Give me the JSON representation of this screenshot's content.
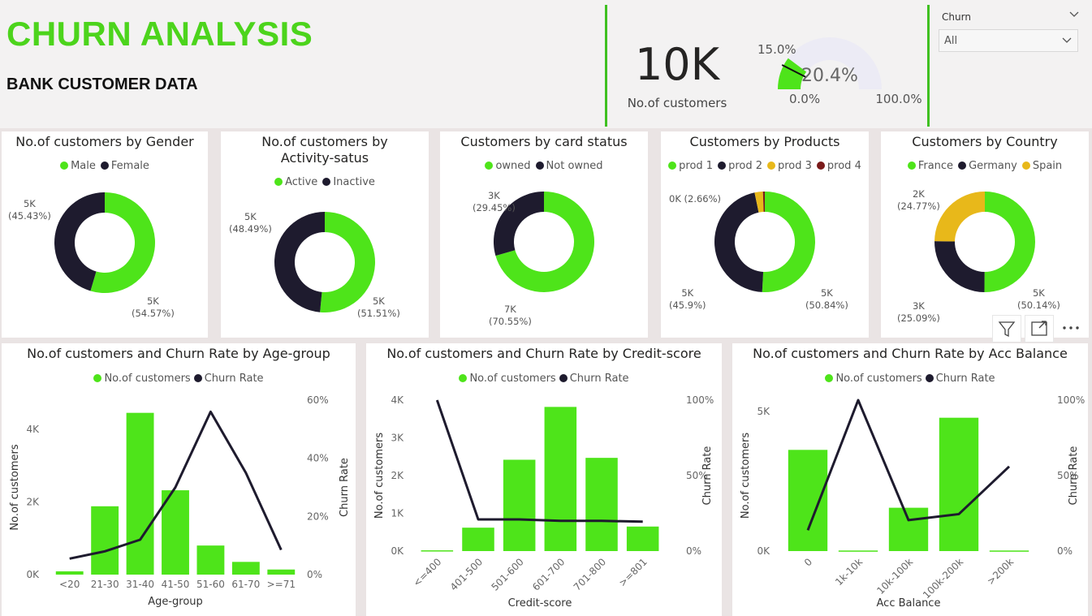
{
  "header": {
    "title": "CHURN ANALYSIS",
    "subtitle": "BANK CUSTOMER DATA"
  },
  "kpi": {
    "value": "10K",
    "label": "No.of customers"
  },
  "gauge": {
    "value": "20.4%",
    "target": "15.0%",
    "min": "0.0%",
    "max": "100.0%",
    "fill_fraction": 0.204,
    "target_fraction": 0.15
  },
  "slicer": {
    "title": "Churn",
    "selected": "All"
  },
  "colors": {
    "green": "#4ee41a",
    "dark": "#1e1b2e",
    "yellow": "#e8b81a",
    "maroon": "#7a1a1a",
    "gauge_bg": "#ecebf5"
  },
  "donuts": [
    {
      "title": "No.of customers by Gender",
      "legend": [
        {
          "label": "Male",
          "color": "#4ee41a"
        },
        {
          "label": "Female",
          "color": "#1e1b2e"
        }
      ],
      "slices": [
        {
          "value": 54.57,
          "color": "#4ee41a"
        },
        {
          "value": 45.43,
          "color": "#1e1b2e"
        }
      ],
      "labels": [
        {
          "line1": "5K",
          "line2": "(45.43%)"
        },
        {
          "line1": "5K",
          "line2": "(54.57%)"
        }
      ]
    },
    {
      "title": "No.of customers by Activity-satus",
      "legend": [
        {
          "label": "Active",
          "color": "#4ee41a"
        },
        {
          "label": "Inactive",
          "color": "#1e1b2e"
        }
      ],
      "slices": [
        {
          "value": 51.51,
          "color": "#4ee41a"
        },
        {
          "value": 48.49,
          "color": "#1e1b2e"
        }
      ],
      "labels": [
        {
          "line1": "5K",
          "line2": "(48.49%)"
        },
        {
          "line1": "5K",
          "line2": "(51.51%)"
        }
      ]
    },
    {
      "title": "Customers by card status",
      "legend": [
        {
          "label": "owned",
          "color": "#4ee41a"
        },
        {
          "label": "Not owned",
          "color": "#1e1b2e"
        }
      ],
      "slices": [
        {
          "value": 70.55,
          "color": "#4ee41a"
        },
        {
          "value": 29.45,
          "color": "#1e1b2e"
        }
      ],
      "labels": [
        {
          "line1": "3K",
          "line2": "(29.45%)"
        },
        {
          "line1": "7K",
          "line2": "(70.55%)"
        }
      ]
    },
    {
      "title": "Customers by Products",
      "legend": [
        {
          "label": "prod 1",
          "color": "#4ee41a"
        },
        {
          "label": "prod 2",
          "color": "#1e1b2e"
        },
        {
          "label": "prod 3",
          "color": "#e8b81a"
        },
        {
          "label": "prod 4",
          "color": "#7a1a1a"
        }
      ],
      "slices": [
        {
          "value": 50.84,
          "color": "#4ee41a"
        },
        {
          "value": 45.9,
          "color": "#1e1b2e"
        },
        {
          "value": 2.66,
          "color": "#e8b81a"
        },
        {
          "value": 0.6,
          "color": "#7a1a1a"
        }
      ],
      "labels": [
        {
          "line1": "0K (2.66%)",
          "line2": ""
        },
        {
          "line1": "5K",
          "line2": "(45.9%)"
        },
        {
          "line1": "5K",
          "line2": "(50.84%)"
        }
      ]
    },
    {
      "title": "Customers by Country",
      "legend": [
        {
          "label": "France",
          "color": "#4ee41a"
        },
        {
          "label": "Germany",
          "color": "#1e1b2e"
        },
        {
          "label": "Spain",
          "color": "#e8b81a"
        }
      ],
      "slices": [
        {
          "value": 50.14,
          "color": "#4ee41a"
        },
        {
          "value": 25.09,
          "color": "#1e1b2e"
        },
        {
          "value": 24.77,
          "color": "#e8b81a"
        }
      ],
      "labels": [
        {
          "line1": "2K",
          "line2": "(24.77%)"
        },
        {
          "line1": "3K",
          "line2": "(25.09%)"
        },
        {
          "line1": "5K",
          "line2": "(50.14%)"
        }
      ]
    }
  ],
  "combo_legend": {
    "bars": "No.of customers",
    "line": "Churn Rate"
  },
  "chart_data": [
    {
      "type": "bar",
      "title": "No.of customers and Churn Rate by Age-group",
      "xlabel": "Age-group",
      "ylabel": "No.of customers",
      "y2label": "Churn Rate",
      "categories": [
        "<20",
        "21-30",
        "31-40",
        "41-50",
        "51-60",
        "61-70",
        ">=71"
      ],
      "series": [
        {
          "name": "No.of customers",
          "type": "bar",
          "values": [
            90,
            1880,
            4450,
            2320,
            800,
            350,
            140
          ]
        },
        {
          "name": "Churn Rate",
          "type": "line",
          "values": [
            5.5,
            8.0,
            12.0,
            30.0,
            56.0,
            35.0,
            8.5
          ]
        }
      ],
      "yticks": [
        "0K",
        "2K",
        "4K"
      ],
      "ylim": [
        0,
        4800
      ],
      "y2ticks": [
        "0%",
        "20%",
        "40%",
        "60%"
      ],
      "y2lim": [
        0,
        60
      ],
      "rotate_x": false
    },
    {
      "type": "bar",
      "title": "No.of customers and Churn Rate by Credit-score",
      "xlabel": "Credit-score",
      "ylabel": "No.of customers",
      "y2label": "Churn Rate",
      "categories": [
        "<=400",
        "401-500",
        "501-600",
        "601-700",
        "701-800",
        ">=801"
      ],
      "series": [
        {
          "name": "No.of customers",
          "type": "bar",
          "values": [
            20,
            620,
            2420,
            3820,
            2470,
            650
          ]
        },
        {
          "name": "Churn Rate",
          "type": "line",
          "values": [
            100,
            21,
            21,
            20,
            20,
            19.5
          ]
        }
      ],
      "yticks": [
        "0K",
        "1K",
        "2K",
        "3K",
        "4K"
      ],
      "ylim": [
        0,
        4000
      ],
      "y2ticks": [
        "0%",
        "50%",
        "100%"
      ],
      "y2lim": [
        0,
        100
      ],
      "rotate_x": true
    },
    {
      "type": "bar",
      "title": "No.of customers and Churn Rate by Acc Balance",
      "xlabel": "Acc Balance",
      "ylabel": "No.of customers",
      "y2label": "Churn Rate",
      "categories": [
        "0",
        "1k-10k",
        "10k-100k",
        "100k-200k",
        ">200k"
      ],
      "series": [
        {
          "name": "No.of customers",
          "type": "bar",
          "values": [
            3620,
            20,
            1550,
            4770,
            20
          ]
        },
        {
          "name": "Churn Rate",
          "type": "line",
          "values": [
            13.8,
            100,
            20.5,
            24.5,
            56
          ]
        }
      ],
      "yticks": [
        "0K",
        "5K"
      ],
      "ylim": [
        0,
        5400
      ],
      "y2ticks": [
        "0%",
        "50%",
        "100%"
      ],
      "y2lim": [
        0,
        100
      ],
      "rotate_x": true
    }
  ],
  "toolbar": {
    "icons": [
      "filter-icon",
      "focus-mode-icon",
      "more-options-icon"
    ]
  }
}
